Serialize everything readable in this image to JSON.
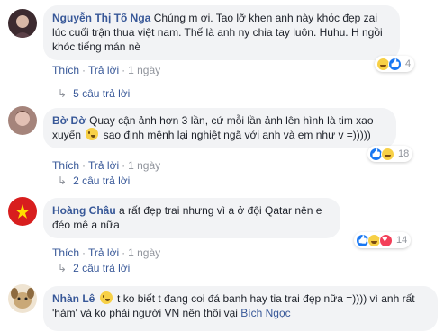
{
  "comments": [
    {
      "author": "Nguyễn Thị Tố Nga",
      "text_before": "Chúng m ơi. Tao lỡ khen anh này khóc đẹp zai lúc cuối trận thua việt nam. Thế là anh ny chia tay luôn. Huhu. H ngồi khóc tiếng mán nè",
      "text_after": "",
      "like_label": "Thích",
      "reply_label": "Trả lời",
      "time": "1 ngày",
      "reaction_count": "4",
      "reactions": [
        "haha-icon",
        "like-icon"
      ],
      "replies_label": "5 câu trả lời",
      "avatar_colors": [
        "#3c2a2f",
        "#d8b7a6"
      ]
    },
    {
      "author": "Bờ Dờ",
      "text_before": "Quay cận ảnh hơn 3 lần, cứ mỗi lần ảnh lên hình là tim xao xuyến",
      "text_after": "sao định mệnh lại nghiệt ngã với anh và em như v =)))))",
      "like_label": "Thích",
      "reply_label": "Trả lời",
      "time": "1 ngày",
      "reaction_count": "18",
      "reactions": [
        "like-icon",
        "haha-icon"
      ],
      "replies_label": "2 câu trả lời",
      "avatar_colors": [
        "#8a6a63",
        "#e2c0b4"
      ]
    },
    {
      "author": "Hoàng Châu",
      "text_before": "a rất đẹp trai nhưng vì a ở đội Qatar nên e đéo mê a nữa",
      "text_after": "",
      "like_label": "Thích",
      "reply_label": "Trả lời",
      "time": "1 ngày",
      "reaction_count": "14",
      "reactions": [
        "like-icon",
        "haha-icon",
        "love-icon"
      ],
      "replies_label": "2 câu trả lời",
      "avatar_colors": [
        "#d81e1e",
        "#ffde00"
      ]
    },
    {
      "author": "Nhàn Lê",
      "text_before": "t ko biết t đang coi đá banh hay tia trai đẹp nữa =)))) vì anh rất 'hám' và ko phải người VN nên thôi vại",
      "mention": "Bích Ngọc",
      "avatar_colors": [
        "#b99a6a",
        "#efe4d2"
      ]
    }
  ]
}
